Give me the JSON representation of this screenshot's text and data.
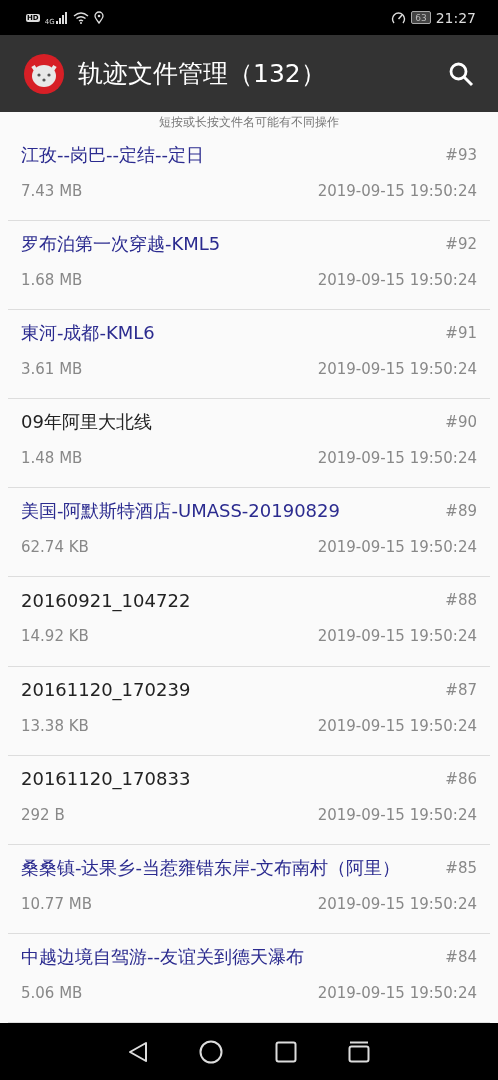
{
  "status_bar": {
    "hd": "HD",
    "network": "4G",
    "battery": "63",
    "time": "21:27"
  },
  "app_bar": {
    "title": "轨迹文件管理（132）"
  },
  "hint": "短按或长按文件名可能有不同操作",
  "files": [
    {
      "name": "江孜--岗巴--定结--定日",
      "index": "#93",
      "size": "7.43 MB",
      "date": "2019-09-15 19:50:24",
      "color": "#2b2b8f"
    },
    {
      "name": "罗布泊第一次穿越-KML5",
      "index": "#92",
      "size": "1.68 MB",
      "date": "2019-09-15 19:50:24",
      "color": "#2b2b8f"
    },
    {
      "name": "東河-成都-KML6",
      "index": "#91",
      "size": "3.61 MB",
      "date": "2019-09-15 19:50:24",
      "color": "#2b2b8f"
    },
    {
      "name": "09年阿里大北线",
      "index": "#90",
      "size": "1.48 MB",
      "date": "2019-09-15 19:50:24",
      "color": "#222222"
    },
    {
      "name": "美国-阿默斯特酒店-UMASS-20190829",
      "index": "#89",
      "size": "62.74 KB",
      "date": "2019-09-15 19:50:24",
      "color": "#2b2b8f"
    },
    {
      "name": "20160921_104722",
      "index": "#88",
      "size": "14.92 KB",
      "date": "2019-09-15 19:50:24",
      "color": "#222222"
    },
    {
      "name": "20161120_170239",
      "index": "#87",
      "size": "13.38 KB",
      "date": "2019-09-15 19:50:24",
      "color": "#222222"
    },
    {
      "name": "20161120_170833",
      "index": "#86",
      "size": "292 B",
      "date": "2019-09-15 19:50:24",
      "color": "#222222"
    },
    {
      "name": "桑桑镇-达果乡-当惹雍错东岸-文布南村（阿里）",
      "index": "#85",
      "size": "10.77 MB",
      "date": "2019-09-15 19:50:24",
      "color": "#2b2b8f"
    },
    {
      "name": "中越边境自驾游--友谊关到德天瀑布",
      "index": "#84",
      "size": "5.06 MB",
      "date": "2019-09-15 19:50:24",
      "color": "#2b2b8f"
    }
  ]
}
